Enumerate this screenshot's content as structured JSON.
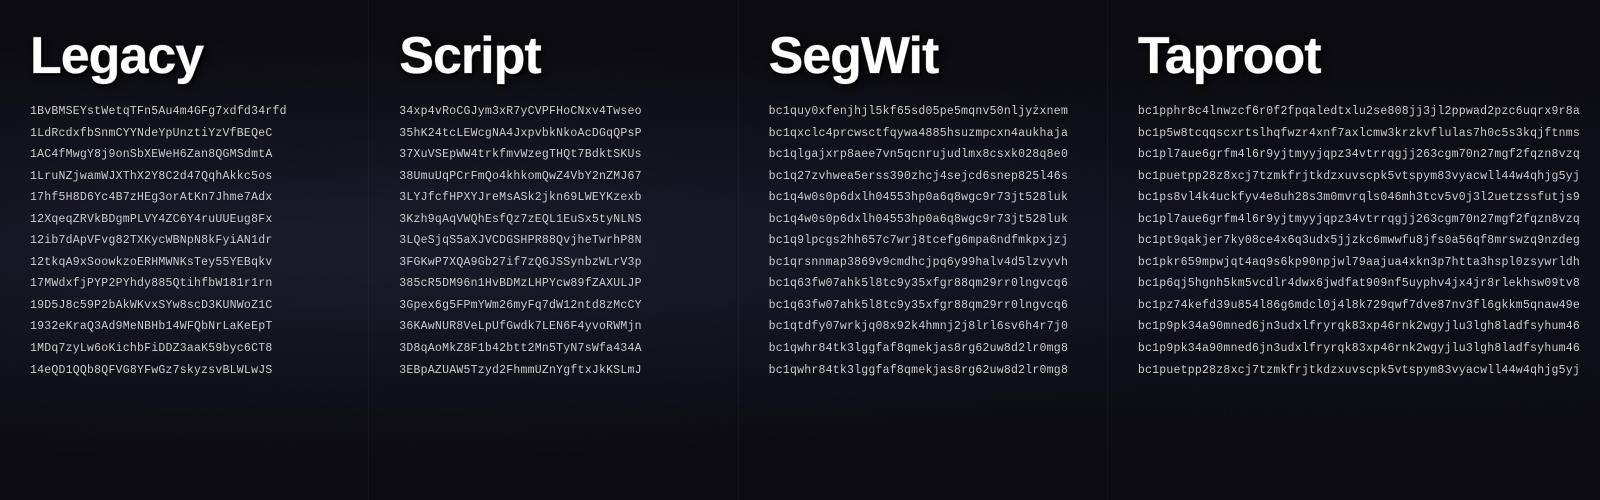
{
  "columns": [
    {
      "id": "legacy",
      "title": "Legacy",
      "addresses": [
        "1BvBMSEYstWetqTFn5Au4m4GFg7xdfd34rfd",
        "1LdRcdxfbSnmCYYNdeYpUnztiYzVfBEQeC",
        "1AC4fMwgY8j9onSbXEWeH6Zan8QGMSdmtA",
        "1LruNZjwamWJXThX2Y8C2d47QqhAkkc5os",
        "17hf5H8D6Yc4B7zHEg3orAtKn7Jhme7Adx",
        "12XqeqZRVkBDgmPLVY4ZC6Y4ruUUEug8Fx",
        "12ib7dApVFvg82TXKycWBNpN8kFyiAN1dr",
        "12tkqA9xSoowkzoERHMWNKsTey55YEBqkv",
        "17MWdxfjPYP2PYhdy885QtihfbW181r1rn",
        "19D5J8c59P2bAkWKvxSYw8scD3KUNWoZ1C",
        "1932eKraQ3Ad9MeNBHb14WFQbNrLaKeEpT",
        "1MDq7zyLw6oKichbFiDDZ3aaK59byc6CT8",
        "14eQD1QQb8QFVG8YFwGz7skyzsvBLWLwJS"
      ]
    },
    {
      "id": "script",
      "title": "Script",
      "addresses": [
        "34xp4vRoCGJym3xR7yCVPFHoCNxv4Twseo",
        "35hK24tcLEWcgNA4JxpvbkNkoAcDGqQPsP",
        "37XuVSEpWW4trkfmvWzegTHQt7BdktSKUs",
        "38UmuUqPCrFmQo4khkomQwZ4VbY2nZMJ67",
        "3LYJfcfHPXYJreMsASk2jkn69LWEYKzexb",
        "3Kzh9qAqVWQhEsfQz7zEQL1EuSx5tyNLNS",
        "3LQeSjqS5aXJVCDGSHPR88QvjheTwrhP8N",
        "3FGKwP7XQA9Gb27if7zQGJSSynbzWLrV3p",
        "385cR5DM96n1HvBDMzLHPYcw89fZAXULJP",
        "3Gpex6g5FPmYWm26myFq7dW12ntd8zMcCY",
        "36KAwNUR8VeLpUfGwdk7LEN6F4yvoRWMjn",
        "3D8qAoMkZ8F1b42btt2Mn5TyN7sWfa434A",
        "3EBpAZUAW5Tzyd2FhmmUZnYgftxJkKSLmJ"
      ]
    },
    {
      "id": "segwit",
      "title": "SegWit",
      "addresses": [
        "bc1quy0xfenjhjl5kf65sd05pe5mqnv50nljyżxnem",
        "bc1qxclc4prcwsctfqywa4885hsuzmpcxn4aukhaja",
        "bc1qlgajxrp8aee7vn5qcnrujudlmx8csxk028q8e0",
        "bc1q27zvhwea5erss390zhcj4sejcd6snep825l46s",
        "bc1q4w0s0p6dxlh04553hp0a6q8wgc9r73jt528luk",
        "bc1q4w0s0p6dxlh04553hp0a6q8wgc9r73jt528luk",
        "bc1q9lpcgs2hh657c7wrj8tcefg6mpa6ndfmkpxjzj",
        "bc1qrsnnmap3869v9cmdhcjpq6y99halv4d5lzvyvh",
        "bc1q63fw07ahk5l8tc9y35xfgr88qm29rr0lngvcq6",
        "bc1q63fw07ahk5l8tc9y35xfgr88qm29rr0lngvcq6",
        "bc1qtdfy07wrkjq08x92k4hmnj2j8lrl6sv6h4r7j0",
        "bc1qwhr84tk3lggfaf8qmekjas8rg62uw8d2lr0mg8",
        "bc1qwhr84tk3lggfaf8qmekjas8rg62uw8d2lr0mg8"
      ]
    },
    {
      "id": "taproot",
      "title": "Taproot",
      "addresses": [
        "bc1pphr8c4lnwzcf6r0f2fpqaledtxlu2se808jj3jl2ppwad2pzc6uqrx9r8a",
        "bc1p5w8tcqqscxrtslhqfwzr4xnf7axlcmw3krzkvflulas7h0c5s3kqjftnms",
        "bc1pl7aue6grfm4l6r9yjtmyyjqpz34vtrrqgjj263cgm70n27mgf2fqzn8vzq",
        "bc1puetpp28z8xcj7tzmkfrjtkdzxuvscpk5vtspym83vyacwll44w4qhjg5yj",
        "bc1ps8vl4k4uckfyv4e8uh28s3m0mvrqls046mh3tcv5v0j3l2uetzssfutjs9",
        "bc1pl7aue6grfm4l6r9yjtmyyjqpz34vtrrqgjj263cgm70n27mgf2fqzn8vzq",
        "bc1pt9qakjer7ky08ce4x6q3udx5jjzkc6mwwfu8jfs0a56qf8mrswzq9nzdeg",
        "bc1pkr659mpwjqt4aq9s6kp90npjwl79aajua4xkn3p7htta3hspl0zsywrldh",
        "bc1p6qj5hgnh5km5vcdlr4dwx6jwdfat909nf5uyphv4jx4jr8rlekhsw09tv8",
        "bc1pz74kefd39u854l86g6mdcl0j4l8k729qwf7dve87nv3fl6gkkm5qnaw49e",
        "bc1p9pk34a90mned6jn3udxlfryrqk83xp46rnk2wgyjlu3lgh8ladfsyhum46",
        "bc1p9pk34a90mned6jn3udxlfryrqk83xp46rnk2wgyjlu3lgh8ladfsyhum46",
        "bc1puetpp28z8xcj7tzmkfrjtkdzxuvscpk5vtspym83vyacwll44w4qhjg5yj"
      ]
    }
  ]
}
